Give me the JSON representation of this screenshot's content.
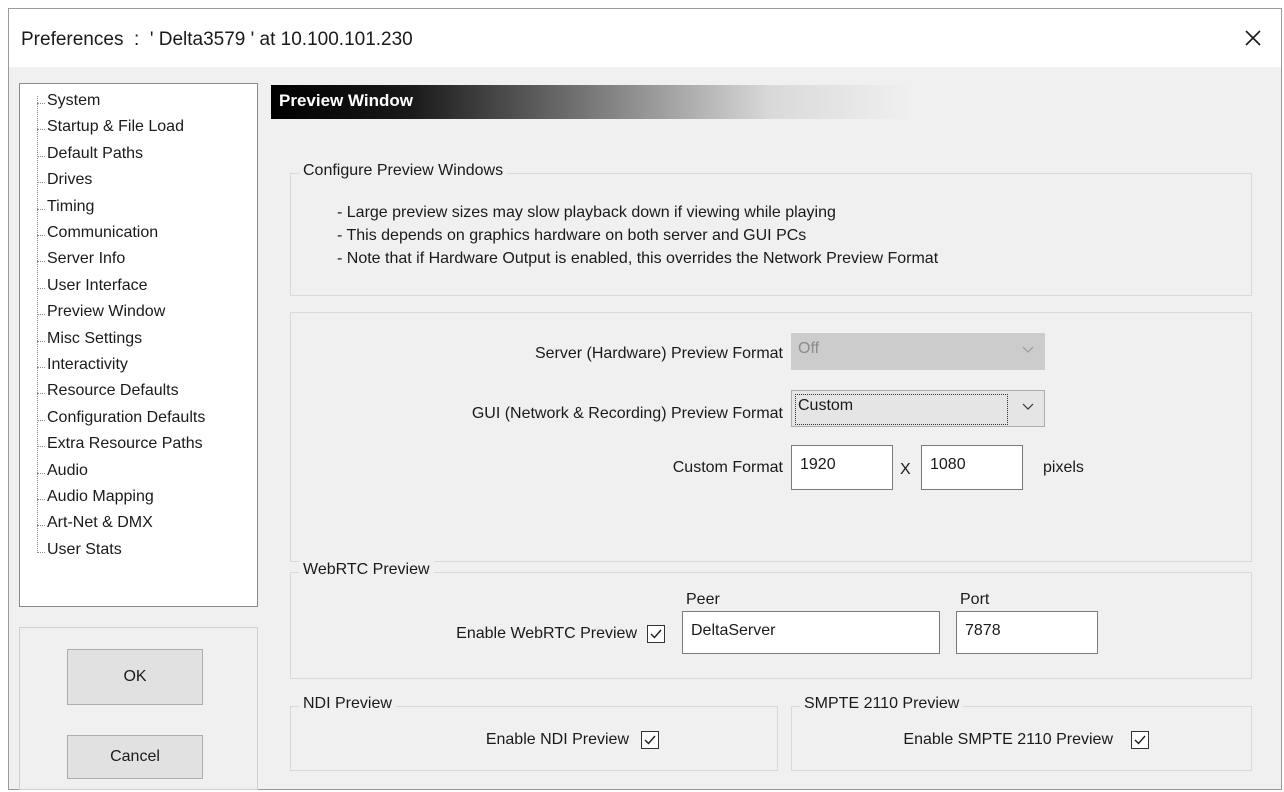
{
  "window": {
    "title": "Preferences  :  ' Delta3579 ' at 10.100.101.230",
    "close_icon": "close-icon"
  },
  "sidebar": {
    "items": [
      {
        "label": "System"
      },
      {
        "label": "Startup & File Load"
      },
      {
        "label": "Default Paths"
      },
      {
        "label": "Drives"
      },
      {
        "label": "Timing"
      },
      {
        "label": "Communication"
      },
      {
        "label": "Server Info"
      },
      {
        "label": "User Interface"
      },
      {
        "label": "Preview Window"
      },
      {
        "label": "Misc Settings"
      },
      {
        "label": "Interactivity"
      },
      {
        "label": "Resource Defaults"
      },
      {
        "label": "Configuration Defaults"
      },
      {
        "label": "Extra Resource Paths"
      },
      {
        "label": "Audio"
      },
      {
        "label": "Audio Mapping"
      },
      {
        "label": "Art-Net & DMX"
      },
      {
        "label": "User Stats"
      }
    ],
    "selected": "Preview Window"
  },
  "buttons": {
    "ok": "OK",
    "cancel": "Cancel"
  },
  "page": {
    "header": "Preview Window",
    "configure_group": {
      "title": "Configure Preview Windows",
      "notes": [
        "- Large preview sizes may slow playback down if viewing while playing",
        "- This depends on graphics hardware on both server and GUI PCs",
        "- Note that if Hardware Output is enabled, this overrides the Network Preview Format"
      ]
    },
    "format_group": {
      "server_label": "Server (Hardware) Preview Format",
      "server_value": "Off",
      "server_enabled": false,
      "gui_label": "GUI (Network & Recording) Preview Format",
      "gui_value": "Custom",
      "custom_label": "Custom Format",
      "custom_width": "1920",
      "custom_x": "X",
      "custom_height": "1080",
      "custom_unit": "pixels"
    },
    "webrtc_group": {
      "title": "WebRTC Preview",
      "enable_label": "Enable WebRTC Preview",
      "enabled": true,
      "peer_label": "Peer",
      "peer_value": "DeltaServer",
      "port_label": "Port",
      "port_value": "7878"
    },
    "ndi_group": {
      "title": "NDI Preview",
      "enable_label": "Enable NDI Preview",
      "enabled": true
    },
    "smpte_group": {
      "title": "SMPTE 2110 Preview",
      "enable_label": "Enable SMPTE 2110 Preview",
      "enabled": true
    }
  },
  "colors": {
    "window_bg": "#f0f0f0",
    "header_start": "#000000",
    "header_end": "#f0f0f0",
    "disabled_combo_bg": "#cccccc",
    "active_combo_bg": "#e5e5e5"
  }
}
